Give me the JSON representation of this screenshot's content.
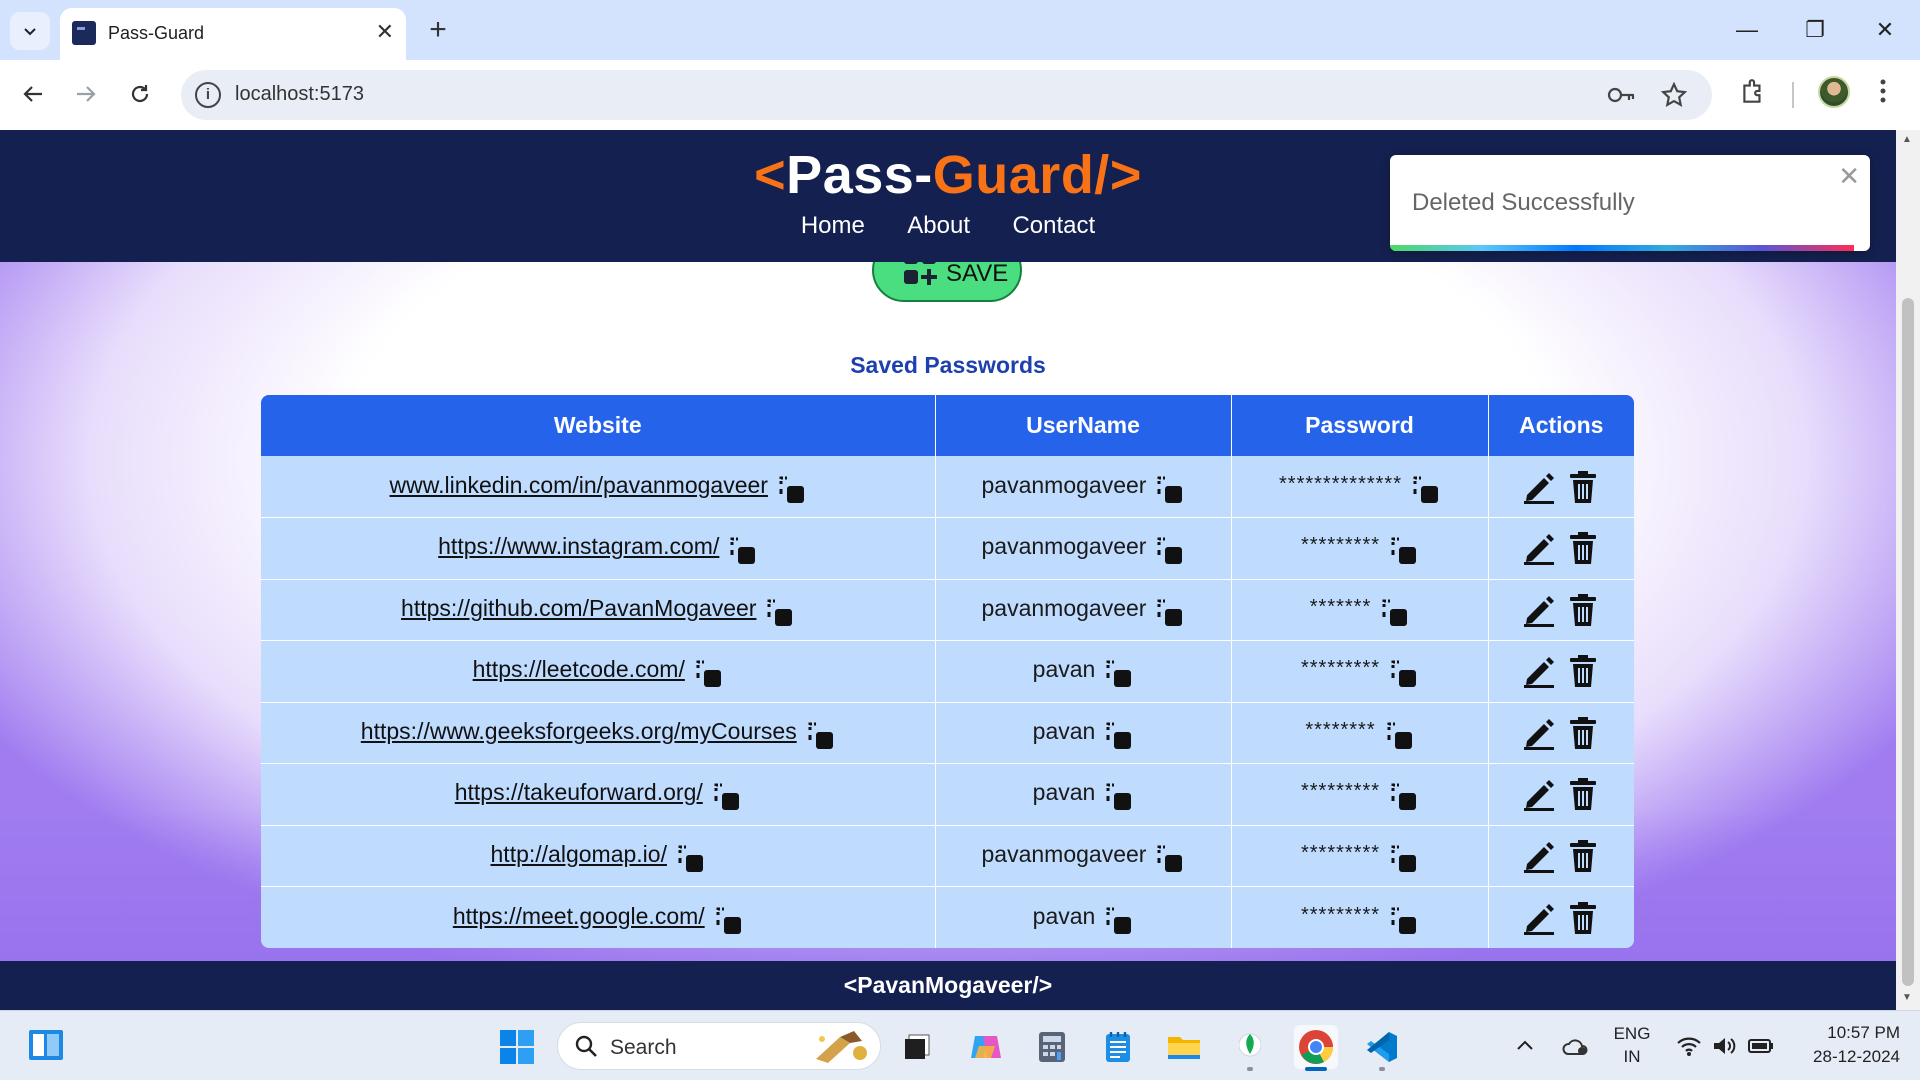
{
  "browser": {
    "tab_title": "Pass-Guard",
    "tab_close": "✕",
    "new_tab": "+",
    "url": "localhost:5173",
    "minimize": "—",
    "restore": "❐",
    "close": "✕"
  },
  "app": {
    "logo_open": "<",
    "logo_pass": "Pass-",
    "logo_guard": "Guard/",
    "logo_close": ">",
    "nav": [
      "Home",
      "About",
      "Contact"
    ],
    "save_label": "SAVE",
    "section_title": "Saved Passwords",
    "columns": [
      "Website",
      "UserName",
      "Password",
      "Actions"
    ],
    "rows": [
      {
        "website": "www.linkedin.com/in/pavanmogaveer",
        "username": "pavanmogaveer",
        "password": "**************"
      },
      {
        "website": "https://www.instagram.com/",
        "username": "pavanmogaveer",
        "password": "*********"
      },
      {
        "website": "https://github.com/PavanMogaveer",
        "username": "pavanmogaveer",
        "password": "*******"
      },
      {
        "website": "https://leetcode.com/",
        "username": "pavan",
        "password": "*********"
      },
      {
        "website": "https://www.geeksforgeeks.org/myCourses",
        "username": "pavan",
        "password": "********"
      },
      {
        "website": "https://takeuforward.org/",
        "username": "pavan",
        "password": "*********"
      },
      {
        "website": "http://algomap.io/",
        "username": "pavanmogaveer",
        "password": "*********"
      },
      {
        "website": "https://meet.google.com/",
        "username": "pavan",
        "password": "*********"
      }
    ],
    "footer": "<PavanMogaveer/>",
    "toast_message": "Deleted Successfully",
    "toast_close": "✕"
  },
  "taskbar": {
    "search_placeholder": "Search",
    "lang_line1": "ENG",
    "lang_line2": "IN",
    "time": "10:57 PM",
    "date": "28-12-2024"
  },
  "colors": {
    "header_bg": "#14204f",
    "accent_orange": "#f97316",
    "table_header": "#2563eb",
    "table_row": "#bfdbfe",
    "save_button": "#4ade80",
    "section_title": "#1e40af"
  }
}
